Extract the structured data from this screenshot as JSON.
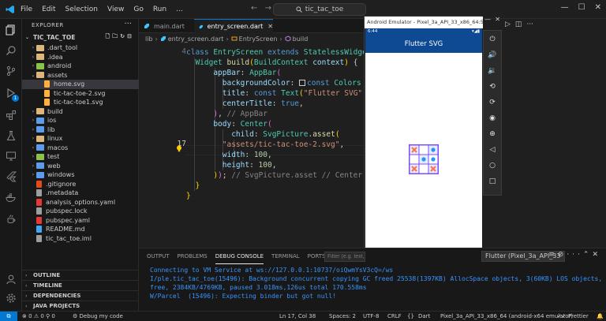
{
  "titlebar": {
    "menu": [
      "File",
      "Edit",
      "Selection",
      "View",
      "Go",
      "Run",
      "..."
    ],
    "search_text": "tic_tac_toe"
  },
  "activity": {
    "badge": "1"
  },
  "explorer": {
    "title": "EXPLORER",
    "project": "TIC_TAC_TOE",
    "tree": [
      {
        "label": ".dart_tool",
        "indent": 1,
        "kind": "folder",
        "chev": "›"
      },
      {
        "label": ".idea",
        "indent": 1,
        "kind": "folder",
        "chev": "›"
      },
      {
        "label": "android",
        "indent": 1,
        "kind": "folder-green",
        "chev": "›"
      },
      {
        "label": "assets",
        "indent": 1,
        "kind": "folder",
        "chev": "⌄"
      },
      {
        "label": "home.svg",
        "indent": 2,
        "kind": "svg",
        "chev": "",
        "selected": true
      },
      {
        "label": "tic-tac-toe-2.svg",
        "indent": 2,
        "kind": "svg",
        "chev": ""
      },
      {
        "label": "tic-tac-toe1.svg",
        "indent": 2,
        "kind": "svg",
        "chev": ""
      },
      {
        "label": "build",
        "indent": 1,
        "kind": "folder",
        "chev": "›"
      },
      {
        "label": "ios",
        "indent": 1,
        "kind": "folder-blue",
        "chev": "›"
      },
      {
        "label": "lib",
        "indent": 1,
        "kind": "folder-blue",
        "chev": "›"
      },
      {
        "label": "linux",
        "indent": 1,
        "kind": "folder",
        "chev": "›"
      },
      {
        "label": "macos",
        "indent": 1,
        "kind": "folder-blue",
        "chev": "›"
      },
      {
        "label": "test",
        "indent": 1,
        "kind": "folder-green",
        "chev": "›"
      },
      {
        "label": "web",
        "indent": 1,
        "kind": "folder-blue",
        "chev": "›"
      },
      {
        "label": "windows",
        "indent": 1,
        "kind": "folder-blue",
        "chev": "›"
      },
      {
        "label": ".gitignore",
        "indent": 1,
        "kind": "git",
        "chev": ""
      },
      {
        "label": ".metadata",
        "indent": 1,
        "kind": "file",
        "chev": ""
      },
      {
        "label": "analysis_options.yaml",
        "indent": 1,
        "kind": "yaml",
        "chev": ""
      },
      {
        "label": "pubspec.lock",
        "indent": 1,
        "kind": "file",
        "chev": ""
      },
      {
        "label": "pubspec.yaml",
        "indent": 1,
        "kind": "yaml",
        "chev": ""
      },
      {
        "label": "README.md",
        "indent": 1,
        "kind": "md",
        "chev": ""
      },
      {
        "label": "tic_tac_toe.iml",
        "indent": 1,
        "kind": "file",
        "chev": ""
      }
    ],
    "sections": [
      "OUTLINE",
      "TIMELINE",
      "DEPENDENCIES",
      "JAVA PROJECTS"
    ]
  },
  "tabs": [
    {
      "label": "main.dart",
      "active": false
    },
    {
      "label": "entry_screen.dart",
      "active": true
    }
  ],
  "breadcrumb": [
    "lib",
    "entry_screen.dart",
    "EntryScreen",
    "build"
  ],
  "editor": {
    "line_numbers": [
      "4",
      "",
      "",
      "",
      "",
      "",
      "",
      "",
      "",
      "17",
      "",
      "",
      "",
      "",
      "",
      ""
    ],
    "lines": [
      [
        [
          "k",
          "class "
        ],
        [
          "t",
          "EntryScreen "
        ],
        [
          "k",
          "extends "
        ],
        [
          "t",
          "StatelessWidget"
        ]
      ],
      [
        [
          "w",
          "  "
        ],
        [
          "t",
          "Widget "
        ],
        [
          "f",
          "build"
        ],
        [
          "y",
          "("
        ],
        [
          "t",
          "BuildContext "
        ],
        [
          "p",
          "context"
        ],
        [
          "y",
          ")"
        ],
        [
          "w",
          " {"
        ]
      ],
      [
        [
          "w",
          "      "
        ],
        [
          "p",
          "appBar"
        ],
        [
          "w",
          ": "
        ],
        [
          "t",
          "AppBar"
        ],
        [
          "pu",
          "("
        ]
      ],
      [
        [
          "w",
          "        "
        ],
        [
          "p",
          "backgroundColor"
        ],
        [
          "w",
          ": "
        ],
        [
          "swatch",
          ""
        ],
        [
          "k",
          "const "
        ],
        [
          "t",
          "Colors"
        ]
      ],
      [
        [
          "w",
          "        "
        ],
        [
          "p",
          "title"
        ],
        [
          "w",
          ": "
        ],
        [
          "k",
          "const "
        ],
        [
          "t",
          "Text"
        ],
        [
          "y",
          "("
        ],
        [
          "s",
          "\"Flutter SVG\""
        ]
      ],
      [
        [
          "w",
          "        "
        ],
        [
          "p",
          "centerTitle"
        ],
        [
          "w",
          ": "
        ],
        [
          "k",
          "true"
        ],
        [
          "w",
          ","
        ]
      ],
      [
        [
          "w",
          "      "
        ],
        [
          "pu",
          ")"
        ],
        [
          "w",
          ", "
        ],
        [
          "c",
          "// AppBar"
        ]
      ],
      [
        [
          "w",
          "      "
        ],
        [
          "p",
          "body"
        ],
        [
          "w",
          ": "
        ],
        [
          "t",
          "Center"
        ],
        [
          "pu",
          "("
        ]
      ],
      [
        [
          "w",
          "          "
        ],
        [
          "p",
          "child"
        ],
        [
          "w",
          ": "
        ],
        [
          "t",
          "SvgPicture"
        ],
        [
          "w",
          "."
        ],
        [
          "f",
          "asset"
        ],
        [
          "y",
          "("
        ]
      ],
      [
        [
          "w",
          "        "
        ],
        [
          "s",
          "\"assets/tic-tac-toe-2.svg\""
        ],
        [
          "w",
          ","
        ]
      ],
      [
        [
          "w",
          "        "
        ],
        [
          "p",
          "width"
        ],
        [
          "w",
          ": "
        ],
        [
          "n",
          "100"
        ],
        [
          "w",
          ","
        ]
      ],
      [
        [
          "w",
          "        "
        ],
        [
          "p",
          "height"
        ],
        [
          "w",
          ": "
        ],
        [
          "n",
          "100"
        ],
        [
          "w",
          ","
        ]
      ],
      [
        [
          "w",
          "      "
        ],
        [
          "y",
          ")"
        ],
        [
          "pu",
          ")"
        ],
        [
          "w",
          "; "
        ],
        [
          "c",
          "// SvgPicture.asset // Center"
        ]
      ],
      [
        [
          "w",
          "  "
        ],
        [
          "y",
          "}"
        ]
      ],
      [
        [
          "y",
          "}"
        ]
      ]
    ]
  },
  "panel": {
    "tabs": [
      "OUTPUT",
      "PROBLEMS",
      "DEBUG CONSOLE",
      "TERMINAL",
      "PORTS"
    ],
    "active_tab": "DEBUG CONSOLE",
    "filter_placeholder": "Filter (e.g. text,",
    "device_select": "Flutter (Pixel_3a_API_33",
    "output": [
      "Connecting to VM Service at ws://127.0.0.1:10737/oiQwmYsV3cQ=/ws",
      "I/ple.tic_tac_toe(15496): Background concurrent copying GC freed 25538(1397KB) AllocSpace objects, 3(60KB) LOS objects, 49%",
      "free, 2384KB/4769KB, paused 3.018ms,126us total 170.558ms",
      "W/Parcel  (15496): Expecting binder but got null!"
    ]
  },
  "emulator": {
    "title": "Android Emulator - Pixel_3a_API_33_x86_64:5554",
    "status_time": "6:44",
    "appbar_title": "Flutter SVG"
  },
  "statusbar": {
    "errors": "0",
    "warnings": "0",
    "ports": "0",
    "debug": "Debug my code",
    "position": "Ln 17, Col 38",
    "spaces": "Spaces: 2",
    "encoding": "UTF-8",
    "eol": "CRLF",
    "language": "Dart",
    "device": "Pixel_3a_API_33_x86_64 (android-x64 emulator)",
    "prettier": "Prettier"
  },
  "colors": {
    "accent": "#0078d4",
    "appbar": "#0d4a93",
    "board_frame": "#7c4dff",
    "board_x": "#ff7043",
    "board_o": "#2196f3"
  }
}
